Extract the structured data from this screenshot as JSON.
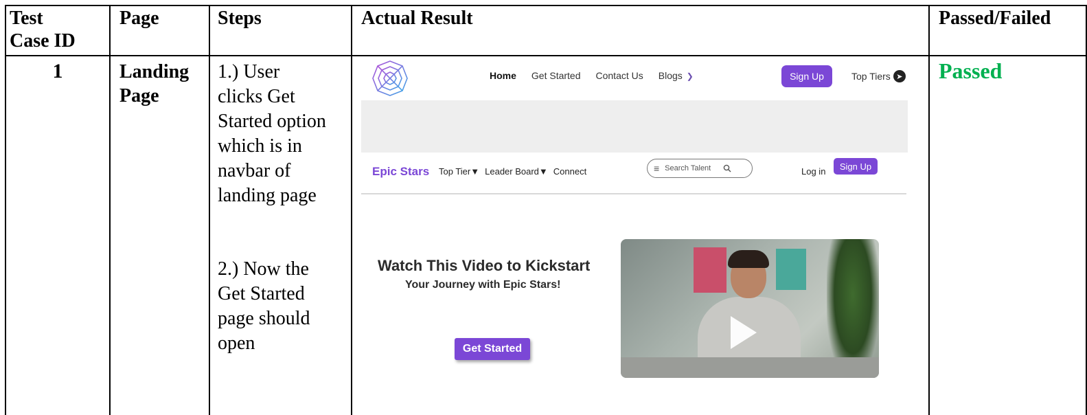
{
  "table": {
    "headers": {
      "test_case_id": "Test\nCase ID",
      "page": "Page",
      "steps": "Steps",
      "actual_result": "Actual Result",
      "status": "Passed/Failed"
    },
    "row": {
      "id": "1",
      "page": "Landing\nPage",
      "step1": "1.) User\nclicks Get\nStarted option\nwhich is in\nnavbar of\nlanding page",
      "step2": "2.) Now the\nGet Started\npage should\nopen",
      "status": "Passed"
    }
  },
  "screenshot": {
    "top_nav": {
      "items": [
        "Home",
        "Get Started",
        "Contact Us",
        "Blogs"
      ],
      "signup": "Sign Up",
      "top_tiers": "Top Tiers"
    },
    "sub_nav": {
      "brand": "Epic Stars",
      "items": [
        "Top Tier",
        "Leader Board",
        "Connect"
      ],
      "search_placeholder": "Search Talent",
      "login": "Log in",
      "signup": "Sign Up"
    },
    "hero": {
      "title": "Watch This Video to Kickstart",
      "subtitle": "Your Journey with Epic Stars!",
      "button": "Get Started"
    },
    "colors": {
      "accent": "#7b47d6",
      "passed": "#00b050"
    }
  }
}
